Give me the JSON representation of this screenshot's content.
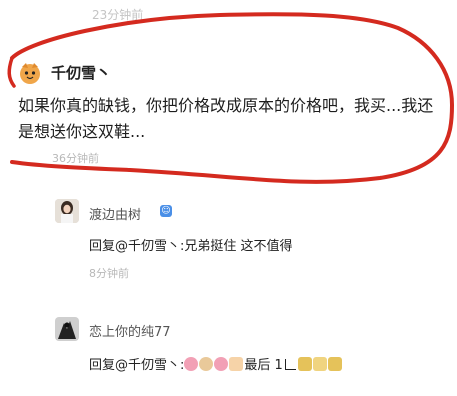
{
  "top_faded_time": "23分钟前",
  "main_comment": {
    "username": "千仞雪丶",
    "text": "如果你真的缺钱，你把价格改成原本的价格吧，我买...我还是想送你这双鞋...",
    "time": "36分钟前",
    "avatar_icon": "cartoon-cat-avatar"
  },
  "replies": [
    {
      "username": "渡边由树",
      "badge_icon": "member-badge-icon",
      "text": "回复@千仞雪丶:兄弟挺住 这不值得",
      "time": "8分钟前",
      "avatar_icon": "girl-photo-avatar"
    },
    {
      "username": "恋上你的纯77",
      "text_prefix": "回复@千仞雪丶:",
      "text_middle": "最后 1",
      "emojis": [
        "pig-face-emoji",
        "dog-face-emoji",
        "pig-face-emoji",
        "hand-emoji",
        "money-bag-emoji",
        "lock-emoji",
        "money-bag-emoji"
      ],
      "avatar_icon": "dark-figure-avatar"
    }
  ],
  "highlight_color": "#d42a1f"
}
